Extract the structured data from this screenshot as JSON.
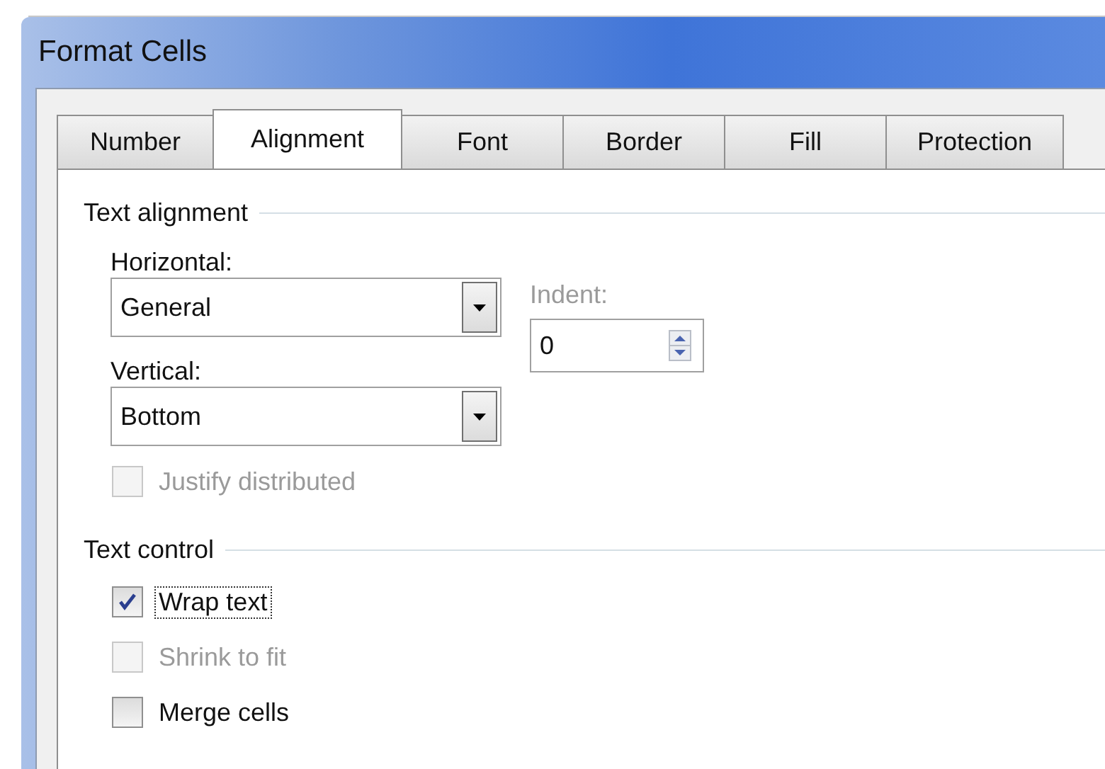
{
  "window": {
    "title": "Format Cells"
  },
  "tabs": [
    {
      "label": "Number",
      "selected": false
    },
    {
      "label": "Alignment",
      "selected": true
    },
    {
      "label": "Font",
      "selected": false
    },
    {
      "label": "Border",
      "selected": false
    },
    {
      "label": "Fill",
      "selected": false
    },
    {
      "label": "Protection",
      "selected": false
    }
  ],
  "text_alignment": {
    "title": "Text alignment",
    "horizontal": {
      "label": "Horizontal:",
      "value": "General"
    },
    "indent": {
      "label": "Indent:",
      "value": "0",
      "disabled": true
    },
    "vertical": {
      "label": "Vertical:",
      "value": "Bottom"
    },
    "justify_distributed": {
      "label": "Justify distributed",
      "checked": false,
      "disabled": true,
      "focused": false
    }
  },
  "text_control": {
    "title": "Text control",
    "options": [
      {
        "label": "Wrap text",
        "checked": true,
        "disabled": false,
        "focused": true
      },
      {
        "label": "Shrink to fit",
        "checked": false,
        "disabled": true,
        "focused": false
      },
      {
        "label": "Merge cells",
        "checked": false,
        "disabled": false,
        "focused": false
      }
    ]
  }
}
